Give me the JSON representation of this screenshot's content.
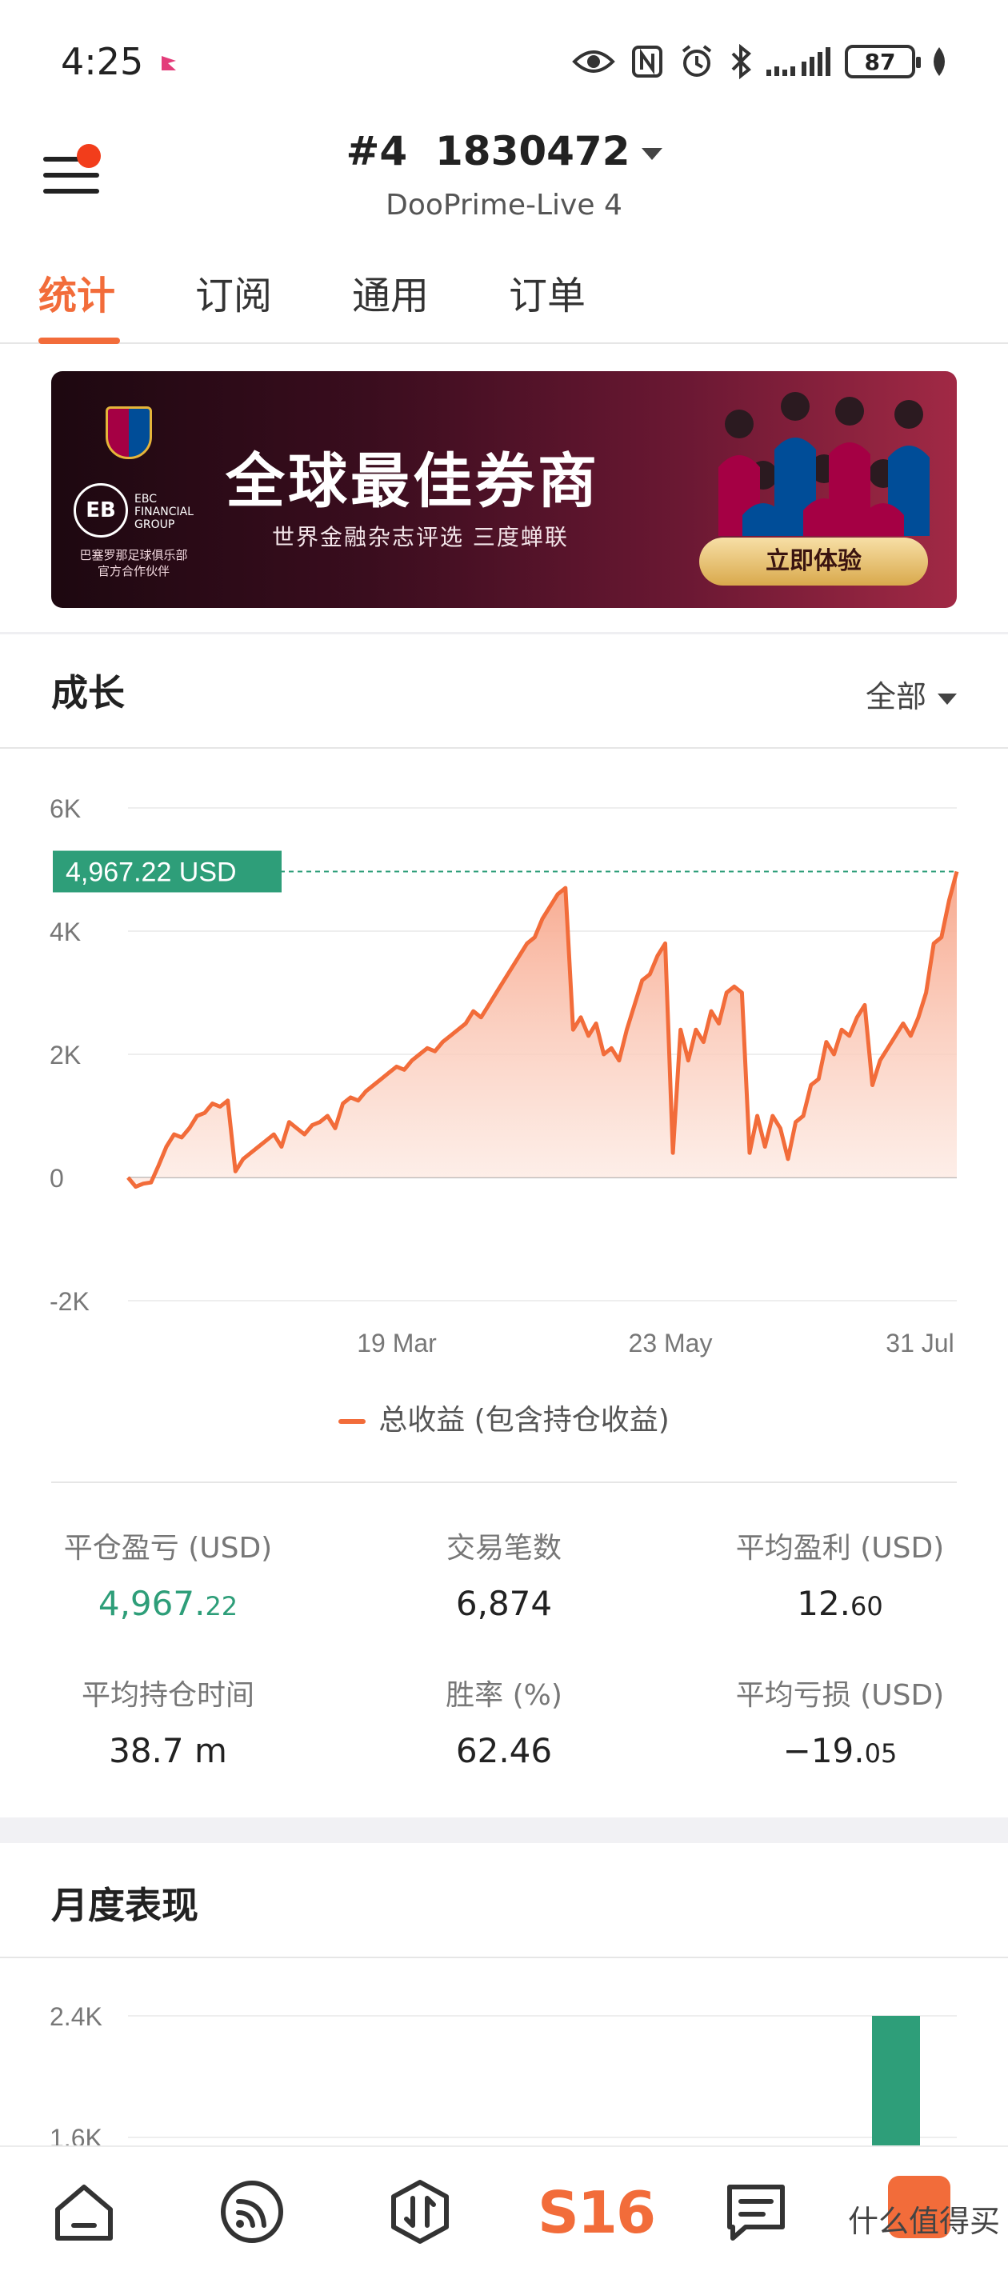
{
  "status_bar": {
    "time": "4:25",
    "battery": "87"
  },
  "header": {
    "account_id": "#4  1830472",
    "server": "DooPrime-Live 4"
  },
  "tabs": [
    {
      "label": "统计",
      "active": true
    },
    {
      "label": "订阅",
      "active": false
    },
    {
      "label": "通用",
      "active": false
    },
    {
      "label": "订单",
      "active": false
    }
  ],
  "banner": {
    "headline": "全球最佳券商",
    "subline": "世界金融杂志评选 三度蝉联",
    "cta": "立即体验",
    "brand_mark": "EB",
    "brand_text": [
      "EBC",
      "FINANCIAL",
      "GROUP"
    ],
    "partner": [
      "巴塞罗那足球俱乐部",
      "官方合作伙伴"
    ]
  },
  "growth": {
    "title": "成长",
    "filter": "全部",
    "current_label": "4,967.22 USD"
  },
  "chart_data": {
    "type": "area",
    "series": [
      {
        "name": "总收益 (包含持仓收益)",
        "color": "#f26c3a",
        "values": [
          0,
          -150,
          -100,
          -80,
          200,
          500,
          700,
          650,
          800,
          1000,
          1050,
          1200,
          1150,
          1250,
          100,
          300,
          400,
          500,
          600,
          700,
          500,
          900,
          800,
          700,
          850,
          900,
          1000,
          800,
          1200,
          1300,
          1250,
          1400,
          1500,
          1600,
          1700,
          1800,
          1750,
          1900,
          2000,
          2100,
          2050,
          2200,
          2300,
          2400,
          2500,
          2700,
          2600,
          2800,
          3000,
          3200,
          3400,
          3600,
          3800,
          3900,
          4200,
          4400,
          4600,
          4700,
          2400,
          2600,
          2300,
          2500,
          2000,
          2100,
          1900,
          2400,
          2800,
          3200,
          3300,
          3600,
          3800,
          400,
          2400,
          1900,
          2400,
          2200,
          2700,
          2500,
          3000,
          3100,
          3000,
          400,
          1000,
          500,
          1000,
          800,
          300,
          900,
          1000,
          1500,
          1600,
          2200,
          2000,
          2400,
          2300,
          2600,
          2800,
          1500,
          1900,
          2100,
          2300,
          2500,
          2300,
          2600,
          3000,
          3800,
          3900,
          4500,
          4967.22
        ]
      }
    ],
    "x_tick_labels": [
      "19 Mar",
      "23 May",
      "31 Jul"
    ],
    "y_tick_labels": [
      "6K",
      "4K",
      "2K",
      "0",
      "-2K"
    ],
    "ylim": [
      -2000,
      6000
    ],
    "current_value": 4967.22,
    "grid": true,
    "legend": "bottom-center"
  },
  "stats": [
    {
      "label": "平仓盈亏 (USD)",
      "value_main": "4,967.",
      "value_small": "22",
      "green": true
    },
    {
      "label": "交易笔数",
      "value_main": "6,874",
      "value_small": ""
    },
    {
      "label": "平均盈利 (USD)",
      "value_main": "12.",
      "value_small": "60"
    },
    {
      "label": "平均持仓时间",
      "value_main": "38.7 m",
      "value_small": ""
    },
    {
      "label": "胜率 (%)",
      "value_main": "62.46",
      "value_small": ""
    },
    {
      "label": "平均亏损 (USD)",
      "value_main": "−19.",
      "value_small": "05"
    }
  ],
  "monthly": {
    "title": "月度表现",
    "chart_data": {
      "type": "bar",
      "y_tick_labels": [
        "2.4K",
        "1.6K"
      ],
      "visible_bar_value": 2400,
      "bar_color": "#2e9e79"
    }
  },
  "bottom_nav": {
    "s16_label": "S16",
    "watermark": "什么值得买"
  },
  "colors": {
    "accent": "#f26c3a",
    "positive": "#2e9e79"
  }
}
